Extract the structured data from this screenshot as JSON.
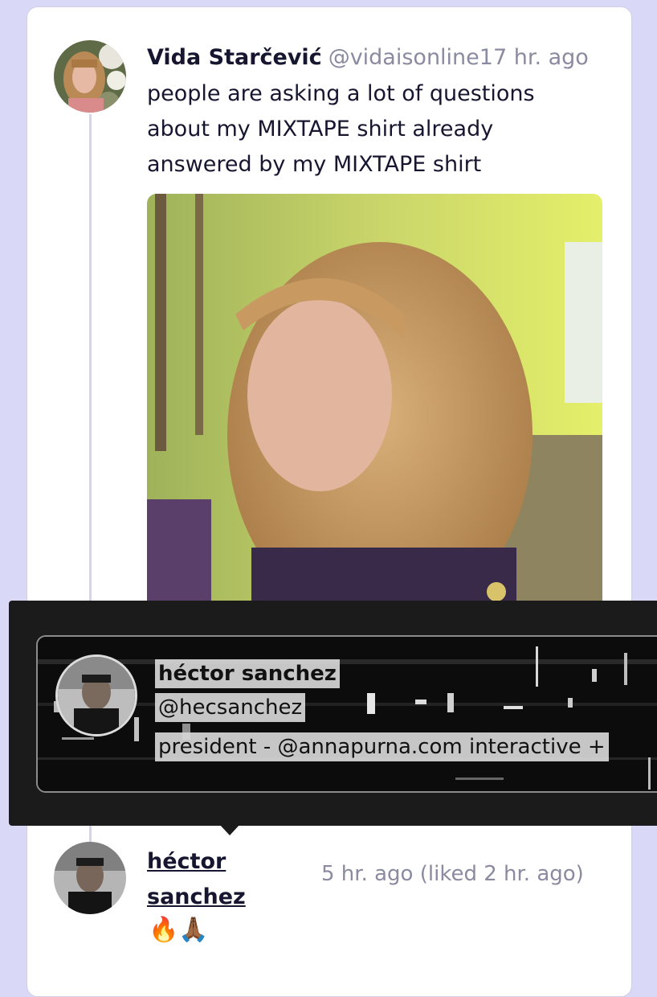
{
  "post": {
    "author_name": "Vida Starčević",
    "author_handle": "@vidaisonline",
    "timestamp": "17 hr. ago",
    "lines": [
      "people are asking a lot of questions",
      "about my MIXTAPE shirt already",
      "answered by my MIXTAPE shirt"
    ]
  },
  "profile_tooltip": {
    "name": "héctor sanchez",
    "handle": "@hecsanchez",
    "bio": "president - @annapurna.com interactive + "
  },
  "reply": {
    "author_name": "héctor sanchez",
    "timestamp": "5 hr. ago (liked 2 hr. ago)",
    "text": "🔥🙏🏾"
  },
  "colors": {
    "background": "#d9d9f7",
    "card": "#ffffff",
    "text": "#161630",
    "muted": "#8a8aa0",
    "tooltip": "#1b1b1b"
  }
}
